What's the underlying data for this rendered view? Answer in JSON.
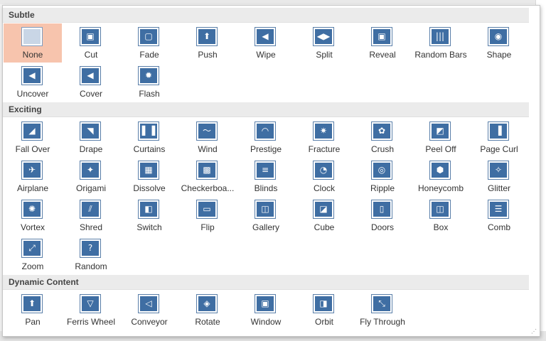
{
  "sections": [
    {
      "title": "Subtle",
      "items": [
        {
          "label": "None",
          "icon": "none-icon",
          "glyph": ""
        },
        {
          "label": "Cut",
          "icon": "cut-icon",
          "glyph": "▣"
        },
        {
          "label": "Fade",
          "icon": "fade-icon",
          "glyph": "▢"
        },
        {
          "label": "Push",
          "icon": "push-icon",
          "glyph": "⬆"
        },
        {
          "label": "Wipe",
          "icon": "wipe-icon",
          "glyph": "◀"
        },
        {
          "label": "Split",
          "icon": "split-icon",
          "glyph": "◀▶"
        },
        {
          "label": "Reveal",
          "icon": "reveal-icon",
          "glyph": "▣"
        },
        {
          "label": "Random Bars",
          "icon": "random-bars-icon",
          "glyph": "|||"
        },
        {
          "label": "Shape",
          "icon": "shape-icon",
          "glyph": "◉"
        },
        {
          "label": "Uncover",
          "icon": "uncover-icon",
          "glyph": "◀"
        },
        {
          "label": "Cover",
          "icon": "cover-icon",
          "glyph": "◀"
        },
        {
          "label": "Flash",
          "icon": "flash-icon",
          "glyph": "✹"
        }
      ]
    },
    {
      "title": "Exciting",
      "items": [
        {
          "label": "Fall Over",
          "icon": "fall-over-icon",
          "glyph": "◢"
        },
        {
          "label": "Drape",
          "icon": "drape-icon",
          "glyph": "◥"
        },
        {
          "label": "Curtains",
          "icon": "curtains-icon",
          "glyph": "▌▐"
        },
        {
          "label": "Wind",
          "icon": "wind-icon",
          "glyph": "〜"
        },
        {
          "label": "Prestige",
          "icon": "prestige-icon",
          "glyph": "◠"
        },
        {
          "label": "Fracture",
          "icon": "fracture-icon",
          "glyph": "✷"
        },
        {
          "label": "Crush",
          "icon": "crush-icon",
          "glyph": "✿"
        },
        {
          "label": "Peel Off",
          "icon": "peel-off-icon",
          "glyph": "◩"
        },
        {
          "label": "Page Curl",
          "icon": "page-curl-icon",
          "glyph": "▐"
        },
        {
          "label": "Airplane",
          "icon": "airplane-icon",
          "glyph": "✈"
        },
        {
          "label": "Origami",
          "icon": "origami-icon",
          "glyph": "✦"
        },
        {
          "label": "Dissolve",
          "icon": "dissolve-icon",
          "glyph": "▦"
        },
        {
          "label": "Checkerboa...",
          "icon": "checkerboard-icon",
          "glyph": "▩"
        },
        {
          "label": "Blinds",
          "icon": "blinds-icon",
          "glyph": "≡"
        },
        {
          "label": "Clock",
          "icon": "clock-icon",
          "glyph": "◔"
        },
        {
          "label": "Ripple",
          "icon": "ripple-icon",
          "glyph": "◎"
        },
        {
          "label": "Honeycomb",
          "icon": "honeycomb-icon",
          "glyph": "⬢"
        },
        {
          "label": "Glitter",
          "icon": "glitter-icon",
          "glyph": "✧"
        },
        {
          "label": "Vortex",
          "icon": "vortex-icon",
          "glyph": "✺"
        },
        {
          "label": "Shred",
          "icon": "shred-icon",
          "glyph": "⫽"
        },
        {
          "label": "Switch",
          "icon": "switch-icon",
          "glyph": "◧"
        },
        {
          "label": "Flip",
          "icon": "flip-icon",
          "glyph": "▭"
        },
        {
          "label": "Gallery",
          "icon": "gallery-icon",
          "glyph": "◫"
        },
        {
          "label": "Cube",
          "icon": "cube-icon",
          "glyph": "◪"
        },
        {
          "label": "Doors",
          "icon": "doors-icon",
          "glyph": "▯"
        },
        {
          "label": "Box",
          "icon": "box-icon",
          "glyph": "◫"
        },
        {
          "label": "Comb",
          "icon": "comb-icon",
          "glyph": "☰"
        },
        {
          "label": "Zoom",
          "icon": "zoom-icon",
          "glyph": "⤢"
        },
        {
          "label": "Random",
          "icon": "random-icon",
          "glyph": "?"
        }
      ]
    },
    {
      "title": "Dynamic Content",
      "items": [
        {
          "label": "Pan",
          "icon": "pan-icon",
          "glyph": "⬆"
        },
        {
          "label": "Ferris Wheel",
          "icon": "ferris-wheel-icon",
          "glyph": "▽"
        },
        {
          "label": "Conveyor",
          "icon": "conveyor-icon",
          "glyph": "◁"
        },
        {
          "label": "Rotate",
          "icon": "rotate-icon",
          "glyph": "◈"
        },
        {
          "label": "Window",
          "icon": "window-icon",
          "glyph": "▣"
        },
        {
          "label": "Orbit",
          "icon": "orbit-icon",
          "glyph": "◨"
        },
        {
          "label": "Fly Through",
          "icon": "fly-through-icon",
          "glyph": "⤡"
        }
      ]
    }
  ],
  "selected": "None",
  "colors": {
    "accent": "#3f6ea3",
    "selected_bg": "#f7c4ad",
    "header_bg": "#ebebeb"
  }
}
